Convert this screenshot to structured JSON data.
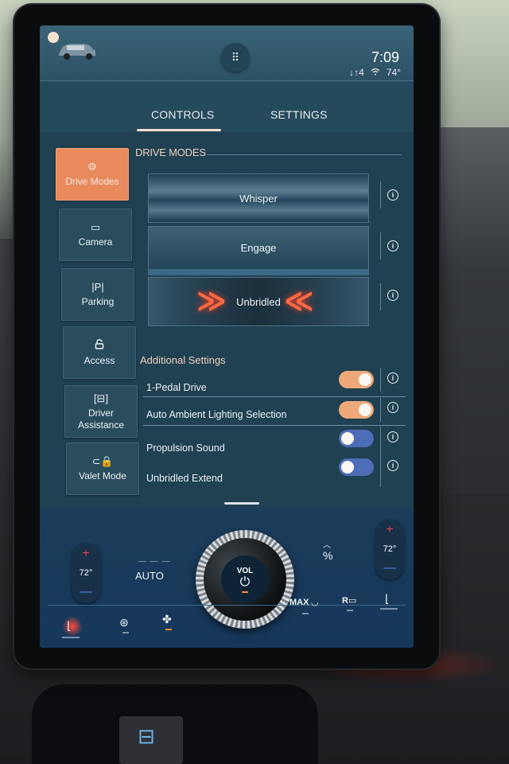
{
  "status_bar": {
    "time": "7:09",
    "network": "↓↑4",
    "wifi_icon": "wifi-icon",
    "outside_temp": "74°",
    "apps_icon": "grid-icon",
    "vehicle_icon": "car-icon"
  },
  "tabs": [
    {
      "label": "CONTROLS",
      "active": true
    },
    {
      "label": "SETTINGS",
      "active": false
    }
  ],
  "sidebar": {
    "items": [
      {
        "label": "Drive Modes",
        "icon": "drive-modes-icon",
        "glyph": "⚙",
        "active": true
      },
      {
        "label": "Camera",
        "icon": "camera-icon",
        "glyph": "▭",
        "active": false
      },
      {
        "label": "Parking",
        "icon": "parking-icon",
        "glyph": "|P|",
        "active": false
      },
      {
        "label": "Access",
        "icon": "lock-open-icon",
        "glyph": "🔓",
        "active": false
      },
      {
        "label": "Driver Assistance",
        "icon": "driver-assist-icon",
        "glyph": "[8]",
        "active": false
      },
      {
        "label": "Valet Mode",
        "icon": "valet-icon",
        "glyph": "⊂8",
        "active": false
      }
    ]
  },
  "drive_modes": {
    "title": "DRIVE MODES",
    "modes": [
      {
        "label": "Whisper",
        "selected": false
      },
      {
        "label": "Engage",
        "selected": true
      },
      {
        "label": "Unbridled",
        "selected": false
      }
    ]
  },
  "additional_settings": {
    "title": "Additional Settings",
    "items": [
      {
        "label": "1-Pedal Drive",
        "on": true
      },
      {
        "label": "Auto Ambient Lighting Selection",
        "on": true
      },
      {
        "label": "Propulsion Sound",
        "on": false
      },
      {
        "label": "Unbridled Extend",
        "on": false
      }
    ]
  },
  "climate": {
    "driver_temp": "72°",
    "passenger_temp": "72°",
    "plus": "+",
    "minus": "—",
    "fan_mode": "AUTO",
    "fan_dashes": "— — —",
    "volume_label": "VOL",
    "power_glyph": "⏻",
    "max_defrost": "MAX",
    "rear_defrost": "R",
    "colors": {
      "heat_plus": "#ef3b4a",
      "cool_minus": "#3f8fe0",
      "indicator_on": "#ff8a3c"
    }
  },
  "accent_colors": {
    "active_tab_underline": "#f6dccd",
    "active_sidebar": "#e88a5c",
    "toggle_on": "#eea877",
    "toggle_off": "#4e6db8"
  }
}
